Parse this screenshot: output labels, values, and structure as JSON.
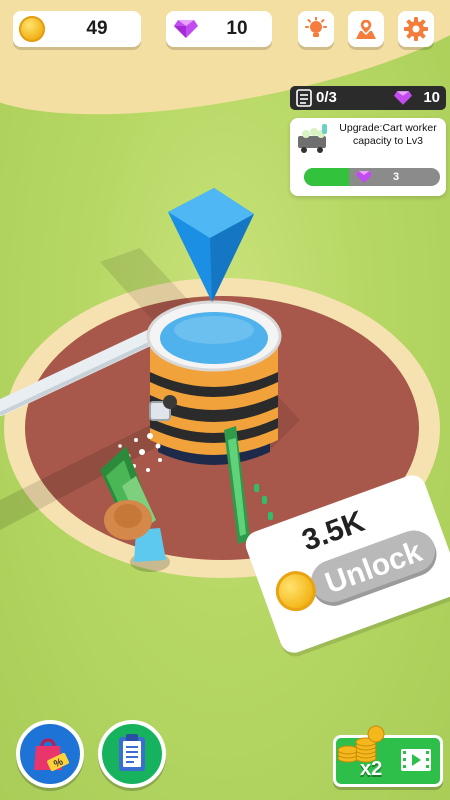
{
  "resources": {
    "coins": "49",
    "gems": "10"
  },
  "top_buttons": {
    "hint": "lightbulb-icon",
    "map": "map-pin-icon",
    "settings": "gear-icon"
  },
  "quest": {
    "progress": "0/3",
    "reward": "10"
  },
  "upgrade": {
    "text": "Upgrade:Cart worker capacity to Lv3",
    "cost": "3",
    "fill_fraction": 0.33
  },
  "unlock": {
    "price": "3.5K",
    "button_label": "Unlock"
  },
  "bottom": {
    "shop_icon": "shopping-bag-discount-icon",
    "tasks_icon": "clipboard-icon",
    "video_multiplier": "x2"
  },
  "colors": {
    "grass": "#b6d764",
    "dirt": "#a7584a",
    "water": "#4fb2ec",
    "marker": "#1a8fe3",
    "progress_fill": "#33c23c",
    "gem": "#c24cf0",
    "coin": "#f4b81d"
  }
}
